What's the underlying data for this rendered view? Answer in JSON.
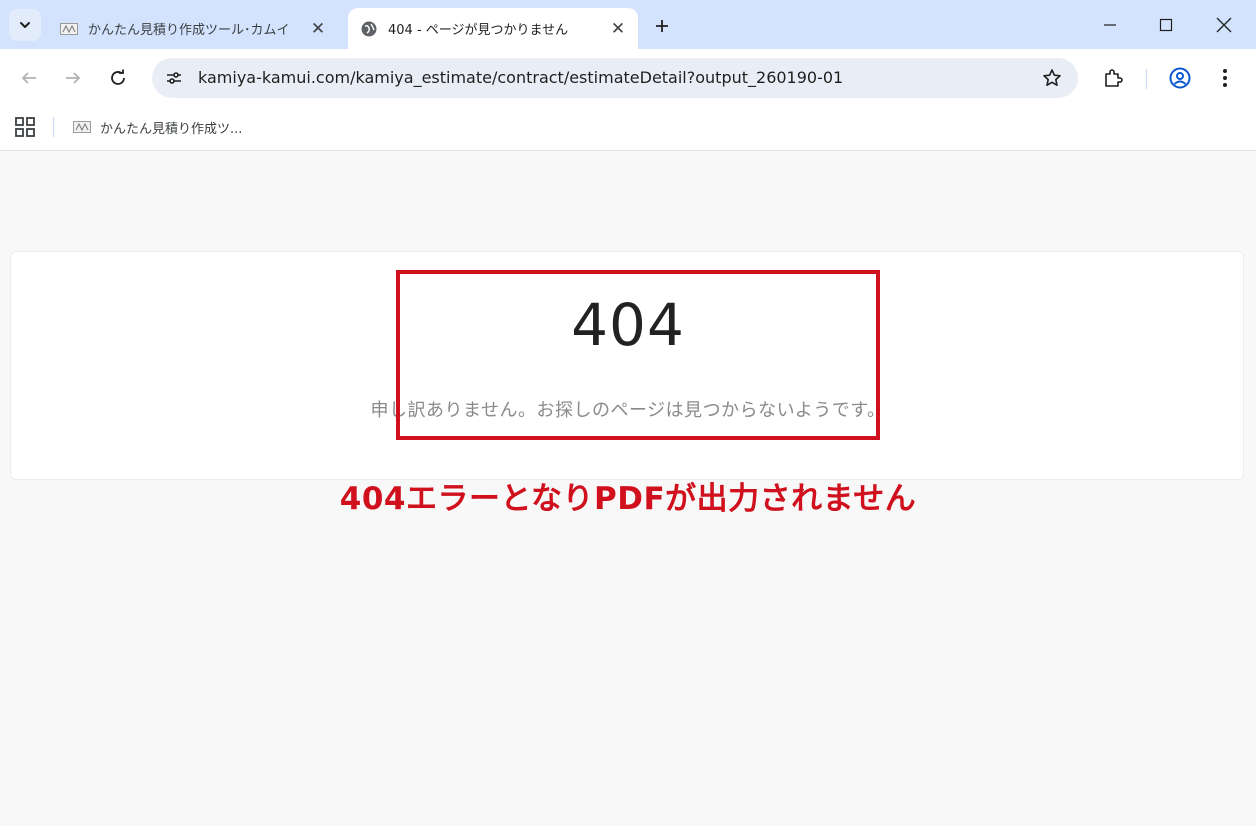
{
  "tabs": [
    {
      "title": "かんたん見積り作成ツール･カムイ",
      "favicon": "kamui-favicon",
      "active": false
    },
    {
      "title": "404 - ページが見つかりません",
      "favicon": "globe-icon",
      "active": true
    }
  ],
  "address_bar": {
    "url": "kamiya-kamui.com/kamiya_estimate/contract/estimateDetail?output_260190-01"
  },
  "bookmarks": [
    {
      "label": "かんたん見積り作成ツ...",
      "favicon": "kamui-favicon"
    }
  ],
  "page": {
    "error_code": "404",
    "message": "申し訳ありません。お探しのページは見つからないようです。"
  },
  "annotation": {
    "text": "404エラーとなりPDFが出力されません",
    "color": "#d0101c"
  },
  "colors": {
    "tabstrip": "#d3e3fd",
    "omnibox": "#e9eef6",
    "profile_accent": "#0b57d0"
  }
}
